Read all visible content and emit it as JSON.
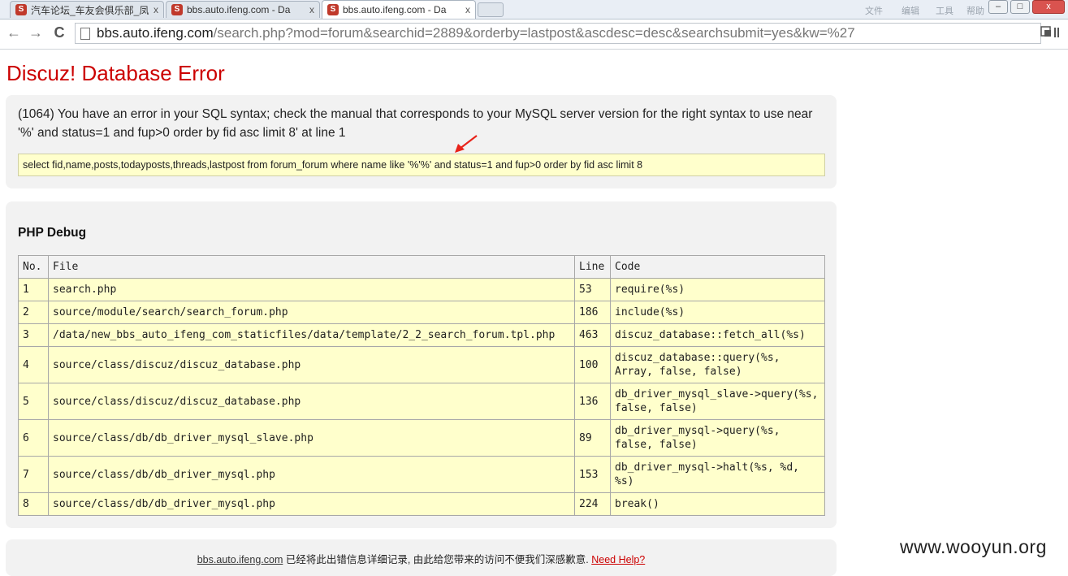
{
  "tabs": [
    {
      "title": "汽车论坛_车友会俱乐部_凤",
      "close": "x",
      "favicon_letter": "S"
    },
    {
      "title": "bbs.auto.ifeng.com - Da",
      "close": "x",
      "favicon_letter": "S"
    },
    {
      "title": "bbs.auto.ifeng.com - Da",
      "close": "x",
      "favicon_letter": "S"
    }
  ],
  "window_controls": {
    "minimize": "–",
    "maximize": "□",
    "close": "x"
  },
  "faded_menu": [
    "文件",
    "编辑",
    "工具",
    "帮助"
  ],
  "nav": {
    "back": "←",
    "forward": "→",
    "reload": "C",
    "url_host": "bbs.auto.ifeng.com",
    "url_path": "/search.php?mod=forum&searchid=2889&orderby=lastpost&ascdesc=desc&searchsubmit=yes&kw=%27"
  },
  "page": {
    "title": "Discuz! Database Error",
    "error_message": "(1064) You have an error in your SQL syntax; check the manual that corresponds to your MySQL server version for the right syntax to use near '%' and status=1 and fup>0 order by fid asc limit 8' at line 1",
    "sql": "select fid,name,posts,todayposts,threads,lastpost from forum_forum where name like '%'%' and status=1 and fup>0 order by fid asc limit 8",
    "debug_header": "PHP Debug",
    "columns": [
      "No.",
      "File",
      "Line",
      "Code"
    ],
    "rows": [
      {
        "no": "1",
        "file": "search.php",
        "line": "53",
        "code": "require(%s)"
      },
      {
        "no": "2",
        "file": "source/module/search/search_forum.php",
        "line": "186",
        "code": "include(%s)"
      },
      {
        "no": "3",
        "file": "/data/new_bbs_auto_ifeng_com_staticfiles/data/template/2_2_search_forum.tpl.php",
        "line": "463",
        "code": "discuz_database::fetch_all(%s)"
      },
      {
        "no": "4",
        "file": "source/class/discuz/discuz_database.php",
        "line": "100",
        "code": "discuz_database::query(%s, Array, false, false)"
      },
      {
        "no": "5",
        "file": "source/class/discuz/discuz_database.php",
        "line": "136",
        "code": "db_driver_mysql_slave->query(%s, false, false)"
      },
      {
        "no": "6",
        "file": "source/class/db/db_driver_mysql_slave.php",
        "line": "89",
        "code": "db_driver_mysql->query(%s, false, false)"
      },
      {
        "no": "7",
        "file": "source/class/db/db_driver_mysql.php",
        "line": "153",
        "code": "db_driver_mysql->halt(%s, %d, %s)"
      },
      {
        "no": "8",
        "file": "source/class/db/db_driver_mysql.php",
        "line": "224",
        "code": "break()"
      }
    ],
    "footer": {
      "site": "bbs.auto.ifeng.com",
      "text": " 已经将此出错信息详细记录, 由此给您带来的访问不便我们深感歉意. ",
      "help": "Need Help?"
    }
  },
  "watermark": "www.wooyun.org",
  "colors": {
    "error_red": "#cc0000",
    "code_bg": "#ffffcc",
    "arrow_red": "#e8231a"
  }
}
